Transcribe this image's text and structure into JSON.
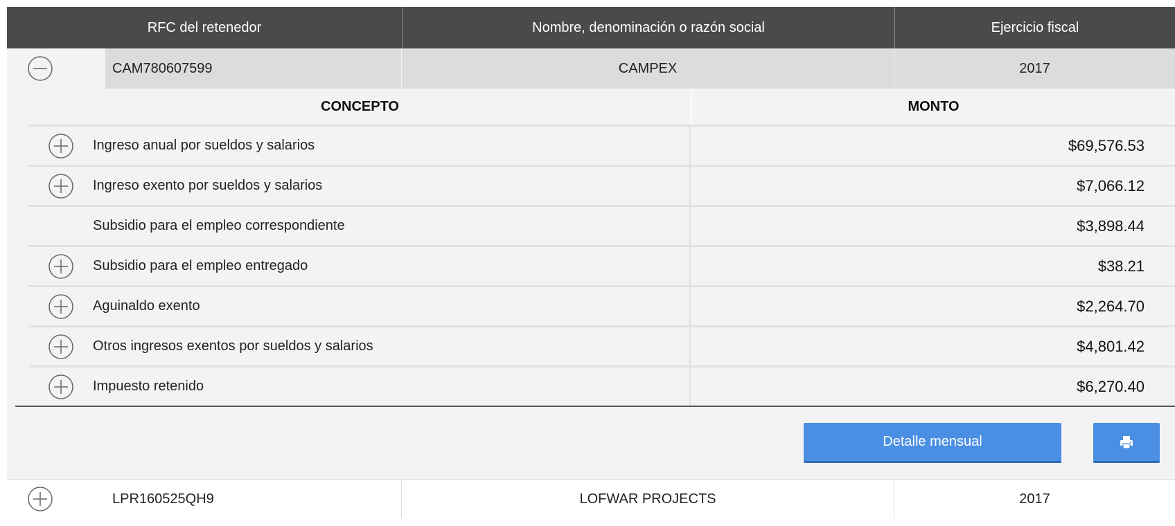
{
  "table": {
    "headers": [
      "RFC del retenedor",
      "Nombre, denominación o razón social",
      "Ejercicio fiscal"
    ]
  },
  "record1": {
    "rfc": "CAM780607599",
    "name": "CAMPEX",
    "year": "2017",
    "toggle_icon": "minus-circle-icon"
  },
  "detail": {
    "col_concepto": "CONCEPTO",
    "col_monto": "MONTO",
    "rows": [
      {
        "label": "Ingreso anual por sueldos y salarios",
        "amount": "$69,576.53",
        "expandable": true
      },
      {
        "label": "Ingreso exento por sueldos y salarios",
        "amount": "$7,066.12",
        "expandable": true
      },
      {
        "label": "Subsidio para el empleo correspondiente",
        "amount": "$3,898.44",
        "expandable": false
      },
      {
        "label": "Subsidio para el empleo entregado",
        "amount": "$38.21",
        "expandable": true
      },
      {
        "label": "Aguinaldo exento",
        "amount": "$2,264.70",
        "expandable": true
      },
      {
        "label": "Otros ingresos exentos por sueldos y salarios",
        "amount": "$4,801.42",
        "expandable": true
      },
      {
        "label": "Impuesto retenido",
        "amount": "$6,270.40",
        "expandable": true
      }
    ],
    "detail_button": "Detalle mensual",
    "print_icon": "printer-icon"
  },
  "record2": {
    "rfc": "LPR160525QH9",
    "name": "LOFWAR PROJECTS",
    "year": "2017",
    "toggle_icon": "plus-circle-icon"
  },
  "colors": {
    "header_bg": "#4a4a4a",
    "button_bg": "#4a8fe4"
  }
}
